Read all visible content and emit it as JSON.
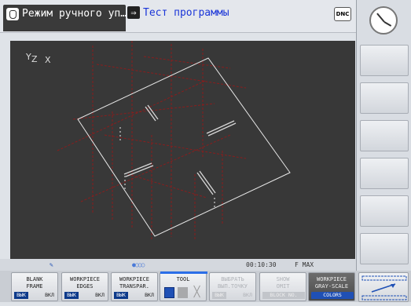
{
  "header": {
    "mode_tab_label": "Режим ручного уп…",
    "program_tab_label": "Тест программы",
    "program_arrow_glyph": "⇒",
    "dnc_badge": "DNC"
  },
  "viewport": {
    "axis": {
      "y": "Y",
      "z": "Z",
      "x": "X"
    }
  },
  "status_bar": {
    "time": "00:10:30",
    "feed": "F MAX"
  },
  "softkeys": [
    {
      "line1": "BLANK",
      "line2": "FRAME",
      "on": "ВЫК",
      "off": "ВКЛ"
    },
    {
      "line1": "WORKPIECE",
      "line2": "EDGES",
      "on": "ВЫК",
      "off": "ВКЛ"
    },
    {
      "line1": "WORKPIECE",
      "line2": "TRANSPAR.",
      "on": "ВЫК",
      "off": "ВКЛ"
    },
    {
      "line1": "TOOL",
      "line2": ""
    },
    {
      "line1": "ВЫБРАТЬ",
      "line2": "ВЫП.ТОЧКУ",
      "on": "ВЫК",
      "off": "ВКЛ"
    },
    {
      "line1": "SHOW",
      "line2": "OMIT",
      "sub": "BLOCK NO."
    },
    {
      "line1": "WORKPIECE",
      "line2": "GRAY-SCALE",
      "sub": "COLORS"
    }
  ],
  "icons": {
    "mode": "hand-icon",
    "clock": "clock-icon",
    "edit": "pencil-icon",
    "page_indicator": "page-dots-icon",
    "next_bar": "softkey-page-arrow-icon"
  }
}
